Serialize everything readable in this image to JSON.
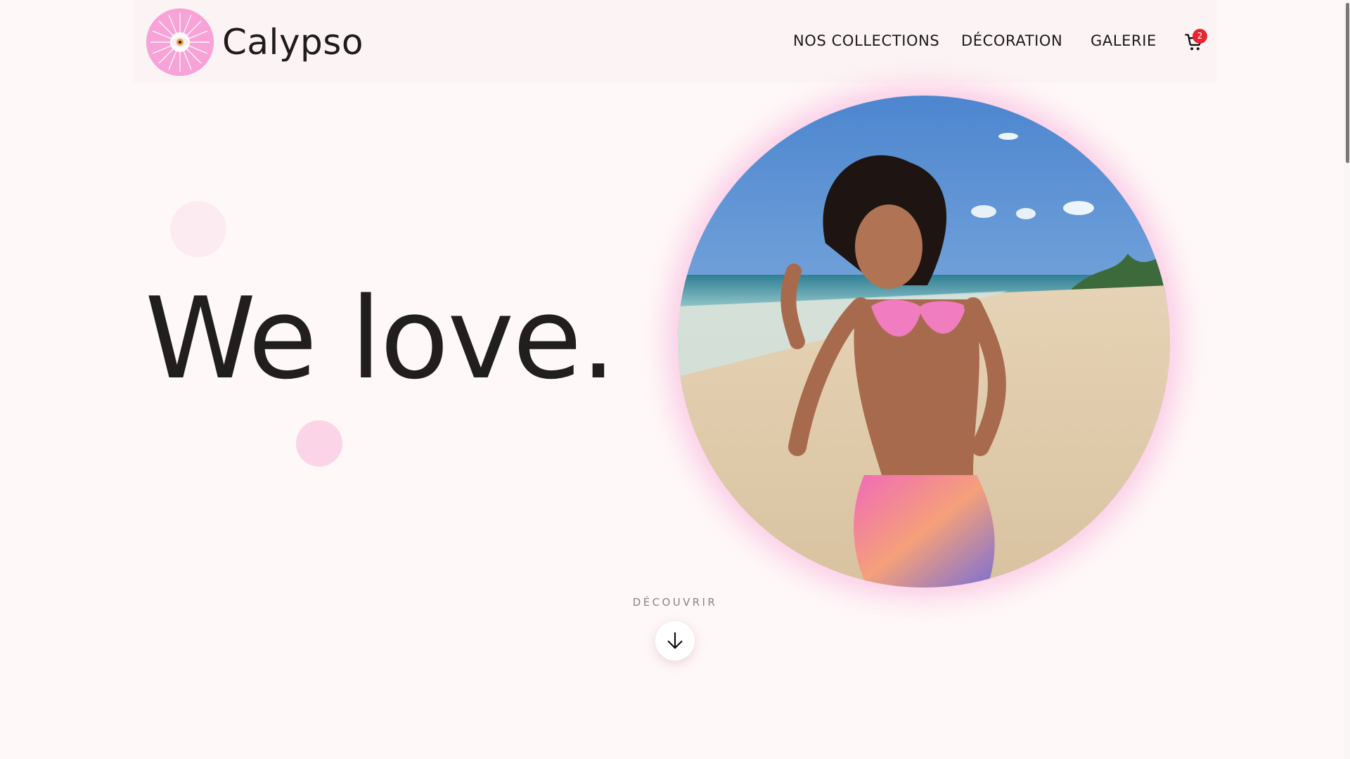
{
  "header": {
    "brand_name": "Calypso",
    "logo_icon": "sun-eye-logo-icon",
    "nav": [
      {
        "label": "NOS COLLECTIONS"
      },
      {
        "label": "DÉCORATION"
      },
      {
        "label": "GALERIE"
      }
    ],
    "cart": {
      "icon": "shopping-cart-icon",
      "count": "2"
    }
  },
  "hero": {
    "headline": "We love.",
    "photo": "beach-woman-photo"
  },
  "discover": {
    "label": "DÉCOUVRIR",
    "icon": "arrow-down-icon"
  },
  "colors": {
    "background": "#fef8f8",
    "accent_pink": "#f7a3d8",
    "badge_red": "#e6262f",
    "text": "#1c1a1a"
  }
}
